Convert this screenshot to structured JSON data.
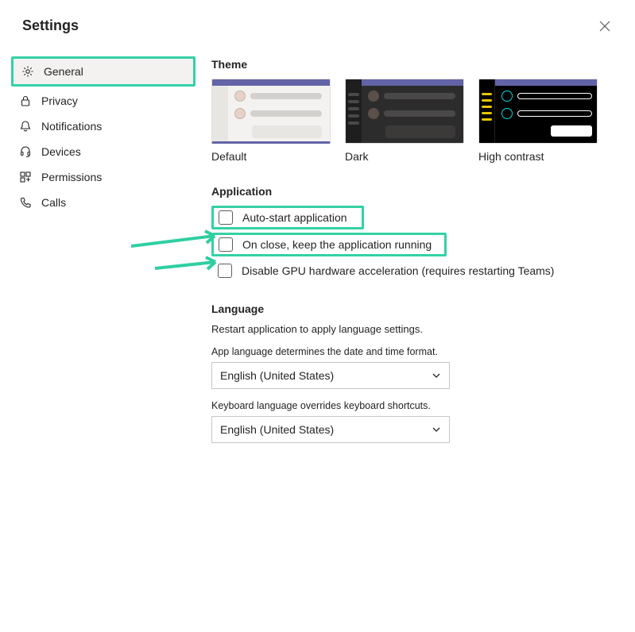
{
  "header": {
    "title": "Settings"
  },
  "sidebar": {
    "items": [
      {
        "label": "General",
        "icon": "gear-icon",
        "active": true
      },
      {
        "label": "Privacy",
        "icon": "lock-icon",
        "active": false
      },
      {
        "label": "Notifications",
        "icon": "bell-icon",
        "active": false
      },
      {
        "label": "Devices",
        "icon": "headset-icon",
        "active": false
      },
      {
        "label": "Permissions",
        "icon": "apps-icon",
        "active": false
      },
      {
        "label": "Calls",
        "icon": "phone-icon",
        "active": false
      }
    ]
  },
  "theme": {
    "title": "Theme",
    "options": [
      {
        "label": "Default",
        "selected": true
      },
      {
        "label": "Dark",
        "selected": false
      },
      {
        "label": "High contrast",
        "selected": false
      }
    ]
  },
  "application": {
    "title": "Application",
    "options": [
      {
        "label": "Auto-start application",
        "checked": false
      },
      {
        "label": "On close, keep the application running",
        "checked": false
      },
      {
        "label": "Disable GPU hardware acceleration (requires restarting Teams)",
        "checked": false
      }
    ]
  },
  "language": {
    "title": "Language",
    "restart_note": "Restart application to apply language settings.",
    "app_lang_desc": "App language determines the date and time format.",
    "app_lang_value": "English (United States)",
    "kb_lang_desc": "Keyboard language overrides keyboard shortcuts.",
    "kb_lang_value": "English (United States)"
  },
  "annotations": {
    "highlight_general": true,
    "highlight_autostart": true,
    "highlight_onclose": true
  }
}
